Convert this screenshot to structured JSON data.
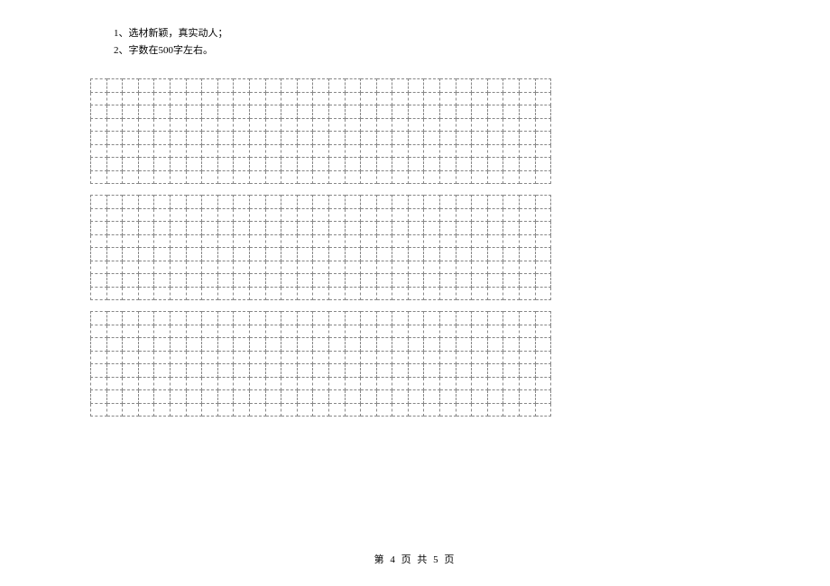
{
  "instructions": {
    "line1": "1、选材新颖，真实动人；",
    "line2": "2、字数在500字左右。"
  },
  "grid": {
    "blocks": 3,
    "rows_per_block": 8,
    "cols": 29
  },
  "footer": {
    "text": "第 4 页 共 5 页"
  }
}
